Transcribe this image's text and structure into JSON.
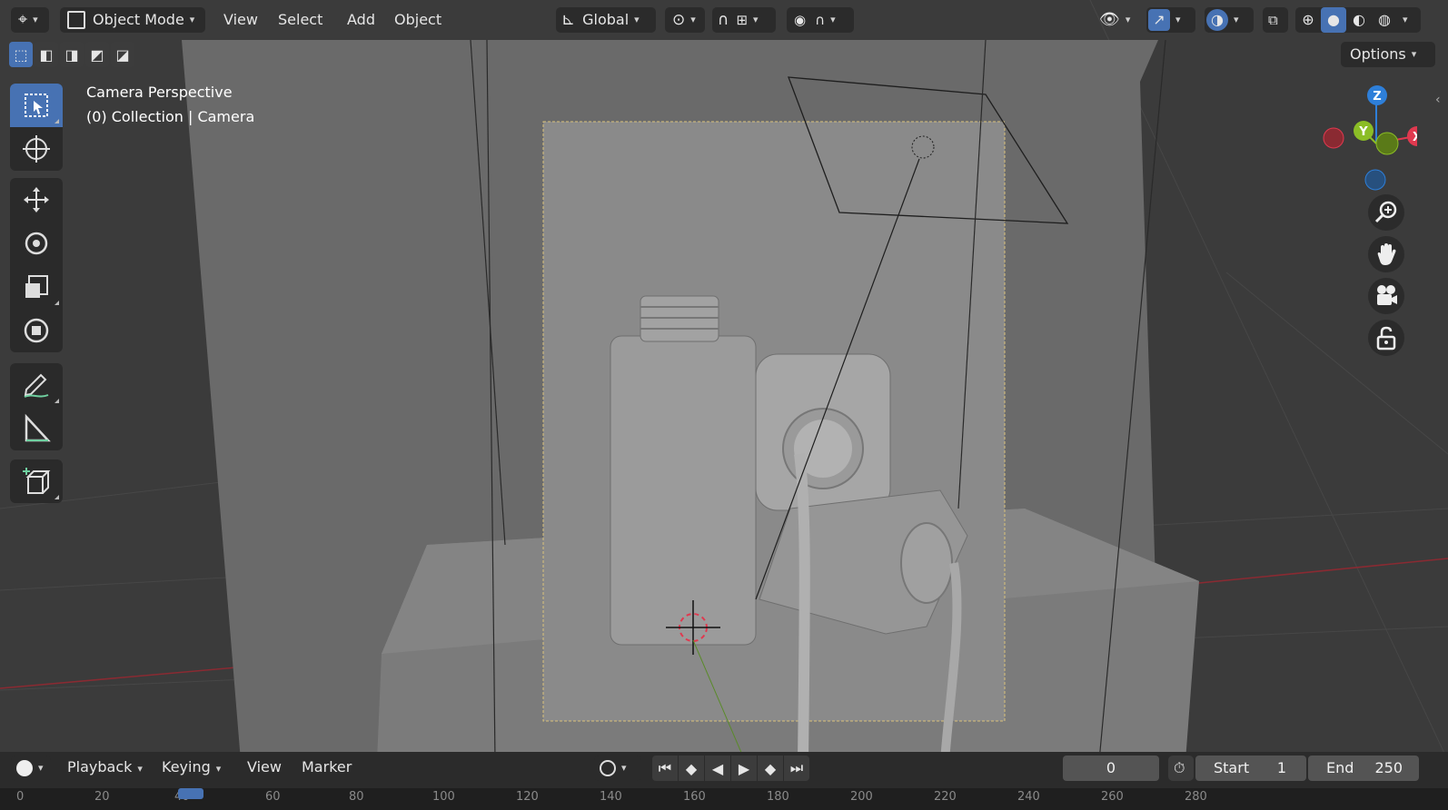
{
  "header": {
    "mode_label": "Object Mode",
    "menus": [
      "View",
      "Select",
      "Add",
      "Object"
    ],
    "transform_orientation": "Global",
    "options_label": "Options"
  },
  "viewport": {
    "view_name": "Camera Perspective",
    "collection_label": "(0) Collection | Camera"
  },
  "gizmo": {
    "axes": [
      "Z",
      "Y",
      "X"
    ],
    "colors": {
      "x": "#e0394f",
      "y": "#8bbd26",
      "z": "#2e7fd9"
    }
  },
  "timeline": {
    "menus": [
      "Playback",
      "Keying",
      "View",
      "Marker"
    ],
    "current_frame": "0",
    "start_label": "Start",
    "start_value": "1",
    "end_label": "End",
    "end_value": "250",
    "ruler_ticks": [
      "0",
      "20",
      "40",
      "60",
      "80",
      "100",
      "120",
      "140",
      "160",
      "180",
      "200",
      "220",
      "240",
      "260",
      "280"
    ]
  },
  "colors": {
    "accent": "#4772b3",
    "header_bg": "#2b2b2b",
    "viewport_bg": "#3a3a3a"
  }
}
